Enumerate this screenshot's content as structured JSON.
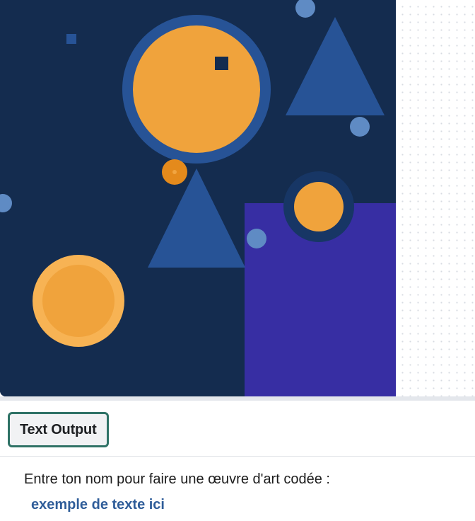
{
  "theme": {
    "canvas_background": "#142c4f",
    "accent_orange": "#f0a33c",
    "accent_blue": "#275396",
    "accent_purple": "#372ea3",
    "tab_border": "#2f7266",
    "example_text_color": "#2f5d99"
  },
  "art": {
    "shapes": [
      "circle",
      "triangle",
      "square",
      "rectangle"
    ]
  },
  "tabs": {
    "active_label": "Text Output"
  },
  "output": {
    "prompt": "Entre ton nom pour faire une œuvre d'art codée :",
    "example": "exemple de texte ici"
  }
}
